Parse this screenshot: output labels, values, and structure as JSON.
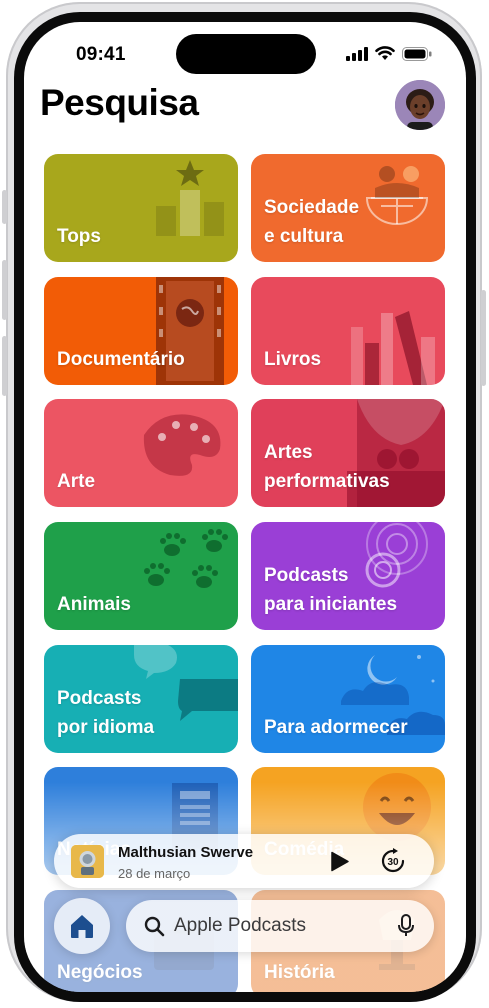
{
  "status_bar": {
    "time": "09:41"
  },
  "header": {
    "title": "Pesquisa"
  },
  "categories": [
    {
      "label": "Tops",
      "color": "#a8a71c",
      "icon": "chart-star-icon"
    },
    {
      "label": "Sociedade\ne cultura",
      "color": "#f06a2e",
      "icon": "globe-people-icon"
    },
    {
      "label": "Documentário",
      "color": "#f25c06",
      "icon": "film-globe-icon"
    },
    {
      "label": "Livros",
      "color": "#e84a5c",
      "icon": "books-icon"
    },
    {
      "label": "Arte",
      "color": "#ec5563",
      "icon": "palette-icon"
    },
    {
      "label": "Artes\nperformativas",
      "color": "#e0405a",
      "icon": "theater-icon"
    },
    {
      "label": "Animais",
      "color": "#1fa04a",
      "icon": "paw-prints-icon"
    },
    {
      "label": "Podcasts\npara iniciantes",
      "color": "#9a3fd6",
      "icon": "target-rings-icon"
    },
    {
      "label": "Podcasts\npor idioma",
      "color": "#17afb4",
      "icon": "speech-bubbles-icon"
    },
    {
      "label": "Para adormecer",
      "color": "#1f86e6",
      "icon": "moon-clouds-icon"
    },
    {
      "label": "Notícias",
      "color": "#2e7fdb",
      "icon": "newspaper-icon"
    },
    {
      "label": "Comédia",
      "color": "#f5a322",
      "icon": "laughing-face-icon"
    },
    {
      "label": "Negócios",
      "color": "#1d55b5",
      "icon": "briefcase-icon"
    },
    {
      "label": "História",
      "color": "#e87018",
      "icon": "lamp-icon"
    }
  ],
  "mini_player": {
    "title": "Malthusian Swerve",
    "date": "28 de março",
    "skip_label": "30"
  },
  "tab_bar": {
    "search_placeholder": "Apple Podcasts"
  }
}
